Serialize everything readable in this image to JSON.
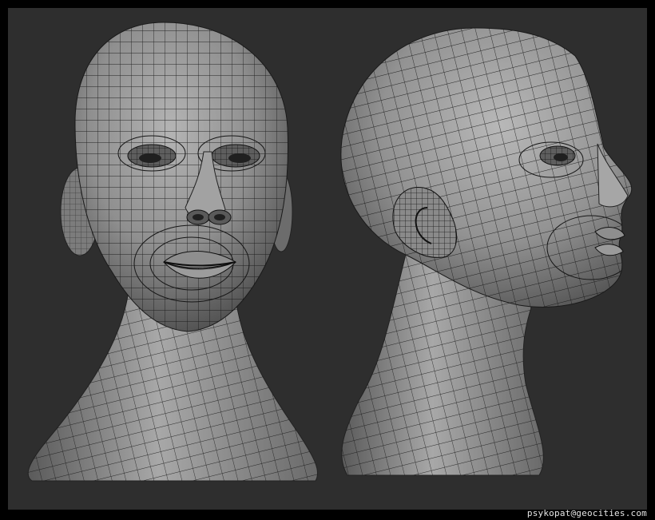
{
  "render": {
    "subject": "Two wireframe 3D head models",
    "views": [
      "front-view",
      "three-quarter-side-view"
    ],
    "colors": {
      "border": "#000000",
      "background": "#2e2e2e",
      "skin_light": "#a9a9a9",
      "skin_mid": "#8a8a8a",
      "skin_dark": "#4d4d4d",
      "mesh_line": "#161616",
      "credit_text": "#e6e6e6"
    }
  },
  "credit": {
    "text": "psykopat@geocities.com"
  }
}
